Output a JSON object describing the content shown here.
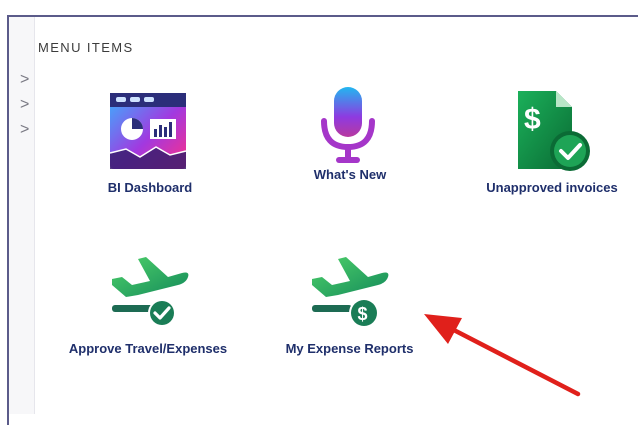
{
  "section": {
    "title": "MENU ITEMS"
  },
  "sidebar": {
    "chevrons": [
      ">",
      ">",
      ">"
    ]
  },
  "tiles": [
    {
      "label": "BI Dashboard",
      "icon": "bi-dashboard-icon"
    },
    {
      "label": "What's New",
      "icon": "microphone-icon"
    },
    {
      "label": "Unapproved invoices",
      "icon": "invoice-check-icon"
    },
    {
      "label": "Approve Travel/Expenses",
      "icon": "plane-check-icon"
    },
    {
      "label": "My Expense Reports",
      "icon": "plane-dollar-icon"
    }
  ],
  "annotation": {
    "arrow_color": "#e0201b"
  }
}
